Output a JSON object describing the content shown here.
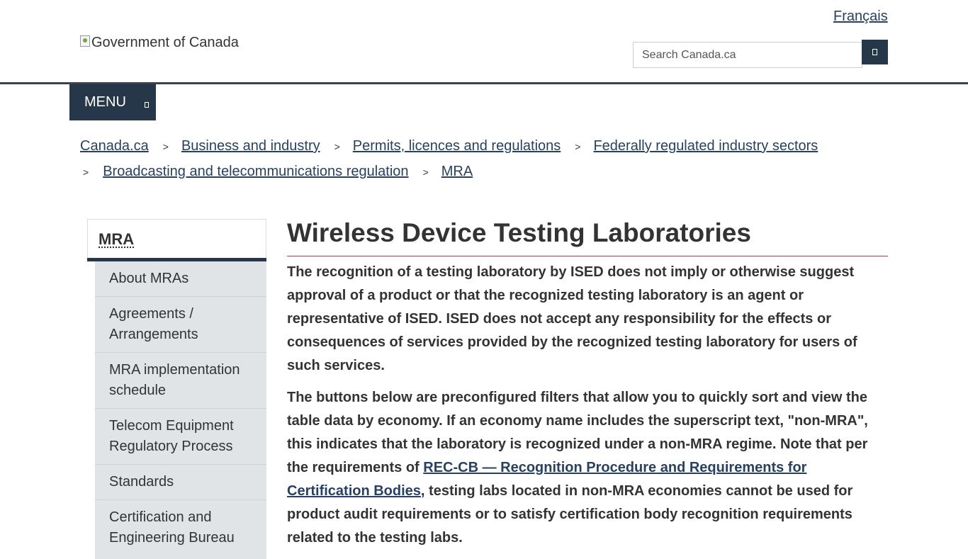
{
  "header": {
    "language_link": "Français",
    "logo_alt": "Government of Canada",
    "search_placeholder": "Search Canada.ca",
    "menu_label": "MENU"
  },
  "breadcrumb": {
    "separator": ">",
    "items": [
      "Canada.ca",
      "Business and industry",
      "Permits, licences and regulations",
      "Federally regulated industry sectors",
      "Broadcasting and telecommunications regulation",
      "MRA"
    ]
  },
  "sidebar": {
    "heading": "MRA",
    "items": [
      "About MRAs",
      "Agreements / Arrangements",
      "MRA implementation schedule",
      "Telecom Equipment Regulatory Process",
      "Standards",
      "Certification and Engineering Bureau"
    ]
  },
  "main": {
    "title": "Wireless Device Testing Laboratories",
    "paragraph1": "The recognition of a testing laboratory by ISED does not imply or otherwise suggest approval of a product or that the recognized testing laboratory is an agent or representative of ISED. ISED does not accept any responsibility for the effects or consequences of services provided by the recognized testing laboratory for users of such services.",
    "paragraph2_before": "The buttons below are preconfigured filters that allow you to quickly sort and view the table data by economy. If an economy name includes the superscript text, \"non-MRA\", this indicates that the laboratory is recognized under a non-MRA regime. Note that per the requirements of ",
    "paragraph2_link": "REC-CB — Recognition Procedure and Requirements for Certification Bodies",
    "paragraph2_after": ", testing labs located in non-MRA economies cannot be used for product audit requirements or to satisfy certification body recognition requirements related to the testing labs."
  },
  "colors": {
    "brand_dark": "#26374a",
    "link": "#284162",
    "title_rule": "#af3c43"
  }
}
